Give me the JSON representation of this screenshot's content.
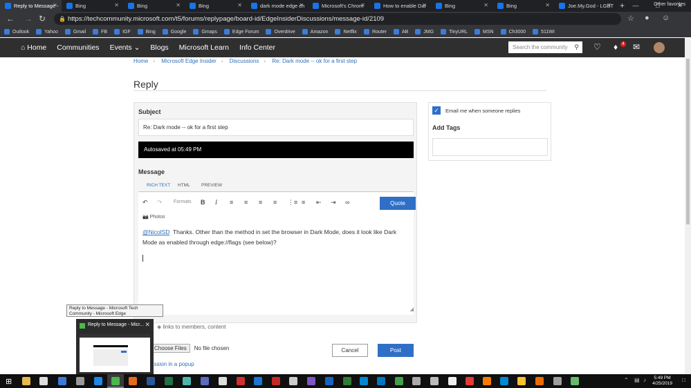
{
  "browser": {
    "tabs": [
      {
        "title": "Reply to Message -"
      },
      {
        "title": "Bing"
      },
      {
        "title": "Bing"
      },
      {
        "title": "Bing"
      },
      {
        "title": "dark mode edge ch"
      },
      {
        "title": "Microsoft's Chrom"
      },
      {
        "title": "How to enable Dar"
      },
      {
        "title": "Bing"
      },
      {
        "title": "Bing"
      },
      {
        "title": "Joe.My.God - LGBT"
      }
    ],
    "url": "https://techcommunity.microsoft.com/t5/forums/replypage/board-id/EdgeInsiderDiscussions/message-id/2109",
    "bookmarks": [
      "Outlook",
      "Yahoo",
      "Gmail",
      "FB",
      "IGF",
      "Bing",
      "Google",
      "Gmaps",
      "Edge Forum",
      "Overdrive",
      "Amazon",
      "Netflix",
      "Router",
      "AB",
      "JMG",
      "TinyURL",
      "MSN",
      "Ch3000",
      "511WI"
    ],
    "other_favorites": "Other favorites"
  },
  "site_nav": {
    "home": "Home",
    "communities": "Communities",
    "events": "Events",
    "blogs": "Blogs",
    "learn": "Microsoft Learn",
    "info": "Info Center",
    "search_placeholder": "Search the community",
    "notification_count": "4"
  },
  "breadcrumb": [
    "Home",
    "Microsoft Edge Insider",
    "Discussions",
    "Re: Dark mode -- ok for a first step"
  ],
  "page_title": "Reply",
  "form": {
    "subject_label": "Subject",
    "subject_value": "Re: Dark mode -- ok for a first step",
    "autosave": "Autosaved at 05:49 PM",
    "message_label": "Message",
    "tabs": [
      "RICH TEXT",
      "HTML",
      "PREVIEW"
    ],
    "formats": "Formats",
    "quote": "Quote",
    "photos": "Photos",
    "mention": "@NicolSD",
    "body_text": "Thanks.  Other than the method in set the browser in Dark Mode, does it look like Dark Mode as enabled through edge://flags (see below)?",
    "links_note": "links to members, content",
    "choose_files": "Choose Files",
    "no_file": "No file chosen",
    "popup_link": "ussion in a popup",
    "cancel": "Cancel",
    "post": "Post"
  },
  "sidebar": {
    "email_label": "Email me when someone replies",
    "tags_label": "Add Tags"
  },
  "taskbar": {
    "tooltip": "Reply to Message - Microsoft Tech Community - Microsoft Edge",
    "preview_title": "Reply to Message - Micr...",
    "time": "5:49 PM",
    "date": "4/25/2019"
  }
}
